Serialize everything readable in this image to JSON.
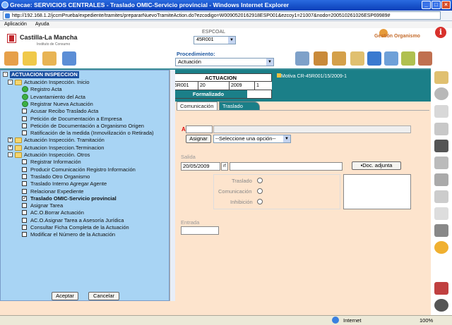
{
  "window": {
    "title": "Grecae: SERVICIOS CENTRALES - Traslado OMIC-Servicio provincial - Windows Internet Explorer",
    "url": "http://192.168.1.2/jccmPrueba/expediente/tramites/prepararNuevoTramiteAction.do?ezcodigo=W0090520162918ESP001&ezcoy1=21007&nodo=200510261026ESP69989#"
  },
  "menubar": {
    "items": [
      "Aplicación",
      "Ayuda"
    ]
  },
  "header": {
    "logo_text": "Castilla-La Mancha",
    "logo_sub": "Instituto de Consumo",
    "espcoal_label": "ESPCOAL",
    "espcoal_value": "45R001",
    "gestion_label": "Gestión Organismo",
    "info_glyph": "i"
  },
  "procedimiento": {
    "label": "Procedimiento:",
    "value": "Actuación"
  },
  "actuacion": {
    "title": "ACTUACION",
    "cells": [
      "45R001",
      "20",
      "2009",
      "1"
    ],
    "status": "Formalizado",
    "motiva": "Motiva CR-45R001/15/2009-1"
  },
  "tabs": {
    "comunicacion": "Comunicación",
    "traslado": "Traslado"
  },
  "form": {
    "a_label": "A",
    "asignar_label": "Asignar",
    "select_placeholder": "--Seleccione una opción--",
    "salida_label": "Salida",
    "salida_date": "20/05/2009",
    "rf_label": "rf",
    "doc_adjunta_label": "Doc. adjunta",
    "radio_traslado": "Traslado",
    "radio_comunicacion": "Comunicación",
    "radio_inhibicion": "Inhibición",
    "entrada_label": "Entrada"
  },
  "tree": {
    "root": "ACTUACION INSPECCION",
    "items": [
      {
        "label": "Actuación Inspección. Inicio",
        "kind": "folder",
        "level": 1,
        "expander": "-"
      },
      {
        "label": "Registro Acta",
        "kind": "green",
        "level": 2
      },
      {
        "label": "Levantamiento del Acta",
        "kind": "green",
        "level": 2
      },
      {
        "label": "Registrar Nueva Actuación",
        "kind": "green",
        "level": 2
      },
      {
        "label": "Acusar Recibo Traslado Acta",
        "kind": "cb",
        "level": 2
      },
      {
        "label": "Petición de Documentación a Empresa",
        "kind": "cb",
        "level": 2
      },
      {
        "label": "Petición de Documentación a Organismo Origen",
        "kind": "cb",
        "level": 2
      },
      {
        "label": "Ratificación de la medida (Inmovilización o Retirada)",
        "kind": "cb",
        "level": 2
      },
      {
        "label": "Actuación Inspección. Tramitación",
        "kind": "folder",
        "level": 1,
        "expander": "+"
      },
      {
        "label": "Actuacion Inspeccion.Terminacion",
        "kind": "folder",
        "level": 1,
        "expander": "+"
      },
      {
        "label": "Actuación Inspección. Otros",
        "kind": "folder",
        "level": 1,
        "expander": "-"
      },
      {
        "label": "Registrar Información",
        "kind": "cb",
        "level": 2
      },
      {
        "label": "Producir Comunicación Registro Información",
        "kind": "cb",
        "level": 2
      },
      {
        "label": "Traslado Otro Organismo",
        "kind": "cb",
        "level": 2
      },
      {
        "label": "Traslado Interno Agregar Agente",
        "kind": "cb",
        "level": 2
      },
      {
        "label": "Relacionar Expediente",
        "kind": "cb",
        "level": 2
      },
      {
        "label": "Traslado OMIC-Servicio provincial",
        "kind": "cb",
        "level": 2,
        "checked": true
      },
      {
        "label": "Asignar Tarea",
        "kind": "cb",
        "level": 2
      },
      {
        "label": "AC.O.Borrar Actuación",
        "kind": "cb",
        "level": 2
      },
      {
        "label": "AC.O.Asignar Tarea a Asesoría Jurídica",
        "kind": "cb",
        "level": 2
      },
      {
        "label": "Consultar Ficha Completa de la Actuación",
        "kind": "cb",
        "level": 2
      },
      {
        "label": "Modificar el Número de la Actuación",
        "kind": "cb",
        "level": 2
      }
    ],
    "aceptar": "Aceptar",
    "cancelar": "Cancelar"
  },
  "status": {
    "zone": "Internet",
    "zoom": "100%"
  },
  "colors": {
    "teal": "#1b7f88",
    "tree_bg": "#a8d4f4",
    "peach": "#fde4cd",
    "titlebar": "#0a3fb8"
  }
}
